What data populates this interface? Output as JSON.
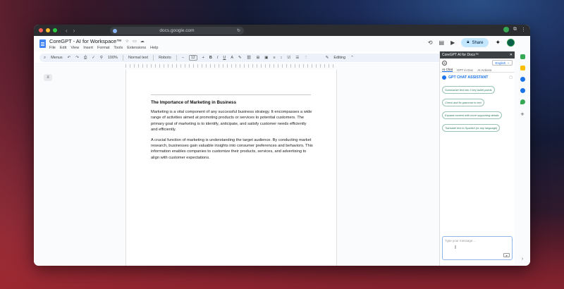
{
  "browser": {
    "url": "docs.google.com",
    "traffic_lights": [
      "#ff5f57",
      "#febc2e",
      "#28c840"
    ]
  },
  "doc": {
    "title": "CoreGPT - AI for Workspace™",
    "menus": [
      "File",
      "Edit",
      "View",
      "Insert",
      "Format",
      "Tools",
      "Extensions",
      "Help"
    ],
    "share_label": "Share"
  },
  "toolbar": {
    "menus_label": "Menus",
    "zoom": "100%",
    "style": "Normal text",
    "font": "Roboto",
    "font_size": "12",
    "mode": "Editing"
  },
  "document": {
    "heading": "The Importance of Marketing in Business",
    "paragraphs": [
      "Marketing is a vital component of any successful business strategy. It encompasses a wide range of activities aimed at promoting products or services to potential customers. The primary goal of marketing is to identify, anticipate, and satisfy customer needs efficiently and efficiently.",
      "A crucial function of marketing is understanding the target audience. By conducting market research, businesses gain valuable insights into consumer preferences and behaviors. This information enables companies to customize their products, services, and advertising to align with customer expectations."
    ]
  },
  "sidebar": {
    "title": "CoreGPT AI for Docs™",
    "language": "English",
    "tabs": [
      "AI Chat",
      "GPT in Doc",
      "AI Actions"
    ],
    "assistant_title": "GPT CHAT ASSISTANT",
    "suggestions": [
      "Summarize text into 3 key bullet points",
      "Check and fix grammar in text",
      "Expand content with more supporting details",
      "Translate text to Spanish (or any language)"
    ],
    "input_placeholder": "Type your message..."
  },
  "colors": {
    "accent": "#1a73e8",
    "share_bg": "#c2e7ff",
    "suggestion_border": "#9ac3b3"
  }
}
